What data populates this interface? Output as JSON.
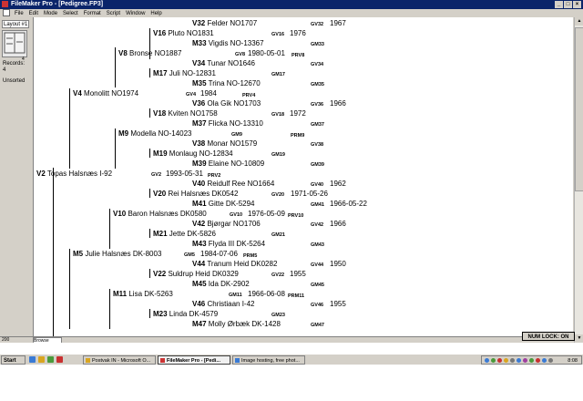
{
  "window": {
    "title": "FileMaker Pro - [Pedigree.FP3]",
    "controls": [
      "_",
      "□",
      "×"
    ]
  },
  "menu": [
    "File",
    "Edit",
    "Mode",
    "Select",
    "Format",
    "Script",
    "Window",
    "Help"
  ],
  "status_area": {
    "layout_select": "Layout #1",
    "slider_value": "4",
    "records_label": "Records:",
    "records_count": "4",
    "sort_status": "Unsorted",
    "book_icon": "book-icon"
  },
  "bottom_bar": {
    "zoom": "200",
    "mode": "Browse",
    "num_lock": "NUM LOCK: ON"
  },
  "pedigree": [
    {
      "gen": "V32",
      "name": "Felder NO1707",
      "ref": "GV32",
      "date": "1967"
    },
    {
      "gen": "V16",
      "name": "Pluto NO1831",
      "ref": "GV16",
      "date": "1976"
    },
    {
      "gen": "M33",
      "name": "Vigdis NO-13367",
      "ref": "GM33",
      "date": ""
    },
    {
      "gen": "V8",
      "name": "Bronse NO1887",
      "ref": "GV8",
      "date": "1980-05-01",
      "extra": "PRV8"
    },
    {
      "gen": "V34",
      "name": "Tunar NO1646",
      "ref": "GV34",
      "date": ""
    },
    {
      "gen": "M17",
      "name": "Juli NO-12831",
      "ref": "GM17",
      "date": ""
    },
    {
      "gen": "M35",
      "name": "Trina NO-12670",
      "ref": "GM35",
      "date": ""
    },
    {
      "gen": "V4",
      "name": "Monolitt NO1974",
      "ref": "GV4",
      "date": "1984",
      "extra": "PRV4"
    },
    {
      "gen": "V36",
      "name": "Ola Gik NO1703",
      "ref": "GV36",
      "date": "1966"
    },
    {
      "gen": "V18",
      "name": "Kviten NO1758",
      "ref": "GV18",
      "date": "1972"
    },
    {
      "gen": "M37",
      "name": "Flicka NO-13310",
      "ref": "GM37",
      "date": ""
    },
    {
      "gen": "M9",
      "name": "Modella NO-14023",
      "ref": "GM9",
      "date": "",
      "extra": "PRM9"
    },
    {
      "gen": "V38",
      "name": "Monar NO1579",
      "ref": "GV38",
      "date": ""
    },
    {
      "gen": "M19",
      "name": "Monlaug NO-12834",
      "ref": "GM19",
      "date": ""
    },
    {
      "gen": "M39",
      "name": "Elaine NO-10809",
      "ref": "GM39",
      "date": ""
    },
    {
      "gen": "V2",
      "name": "Topas Halsnæs I-92",
      "ref": "GV2",
      "date": "1993-05-31",
      "extra": "PRV2"
    },
    {
      "gen": "V40",
      "name": "Reidulf Ree NO1664",
      "ref": "GV40",
      "date": "1962"
    },
    {
      "gen": "V20",
      "name": "Rei Halsnæs DK0542",
      "ref": "GV20",
      "date": "1971-05-26"
    },
    {
      "gen": "M41",
      "name": "Gitte DK-5294",
      "ref": "GM41",
      "date": "1966-05-22"
    },
    {
      "gen": "V10",
      "name": "Baron Halsnæs DK0580",
      "ref": "GV10",
      "date": "1976-05-09",
      "extra": "PRV10"
    },
    {
      "gen": "V42",
      "name": "Bjørgar NO1706",
      "ref": "GV42",
      "date": "1966"
    },
    {
      "gen": "M21",
      "name": "Jette DK-5826",
      "ref": "GM21",
      "date": ""
    },
    {
      "gen": "M43",
      "name": "Flyda III DK-5264",
      "ref": "GM43",
      "date": ""
    },
    {
      "gen": "M5",
      "name": "Julie Halsnæs DK-8003",
      "ref": "GM5",
      "date": "1984-07-06",
      "extra": "PRM5"
    },
    {
      "gen": "V44",
      "name": "Tranum Heid DK0282",
      "ref": "GV44",
      "date": "1950"
    },
    {
      "gen": "V22",
      "name": "Suldrup Heid DK0329",
      "ref": "GV22",
      "date": "1955"
    },
    {
      "gen": "M45",
      "name": "Ida DK-2902",
      "ref": "GM45",
      "date": ""
    },
    {
      "gen": "M11",
      "name": "Lisa DK-5263",
      "ref": "GM11",
      "date": "1966-06-08",
      "extra": "PRM11"
    },
    {
      "gen": "V46",
      "name": "Christiaan I-42",
      "ref": "GV46",
      "date": "1955"
    },
    {
      "gen": "M23",
      "name": "Linda DK-4579",
      "ref": "GM23",
      "date": ""
    },
    {
      "gen": "M47",
      "name": "Molly Ørbæk DK-1428",
      "ref": "GM47",
      "date": ""
    }
  ],
  "taskbar": {
    "start": "Start",
    "tasks": [
      "Postvak IN - Microsoft O...",
      "FileMaker Pro - [Pedi...",
      "Image hosting, free phot..."
    ],
    "clock": "8:08"
  }
}
